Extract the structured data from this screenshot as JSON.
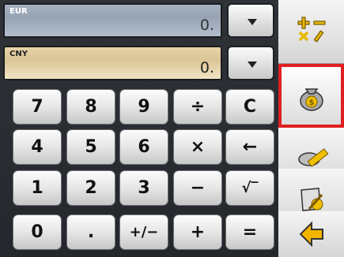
{
  "display": {
    "from": {
      "currency": "EUR",
      "value": "0."
    },
    "to": {
      "currency": "CNY",
      "value": "0."
    }
  },
  "keys": [
    {
      "label": "7",
      "name": "key-7"
    },
    {
      "label": "8",
      "name": "key-8"
    },
    {
      "label": "9",
      "name": "key-9"
    },
    {
      "label": "÷",
      "name": "key-divide"
    },
    {
      "label": "C",
      "name": "key-clear"
    },
    {
      "label": "4",
      "name": "key-4"
    },
    {
      "label": "5",
      "name": "key-5"
    },
    {
      "label": "6",
      "name": "key-6"
    },
    {
      "label": "×",
      "name": "key-multiply"
    },
    {
      "label": "←",
      "name": "key-backspace"
    },
    {
      "label": "1",
      "name": "key-1"
    },
    {
      "label": "2",
      "name": "key-2"
    },
    {
      "label": "3",
      "name": "key-3"
    },
    {
      "label": "−",
      "name": "key-subtract"
    },
    {
      "label": "√‾",
      "name": "key-sqrt"
    },
    {
      "label": "0",
      "name": "key-0"
    },
    {
      "label": ".",
      "name": "key-decimal"
    },
    {
      "label": "+/−",
      "name": "key-negate"
    },
    {
      "label": "+",
      "name": "key-add"
    },
    {
      "label": "=",
      "name": "key-equals"
    }
  ],
  "sidebar": [
    {
      "icon": "calculator-operations-icon"
    },
    {
      "icon": "money-bag-icon",
      "selected": true
    },
    {
      "icon": "ruler-units-icon"
    },
    {
      "icon": "note-edit-icon"
    },
    {
      "icon": "back-arrow-icon"
    }
  ],
  "colors": {
    "selection": "#e02020",
    "from_display": "#a7b3c2",
    "to_display": "#e7d3a8"
  }
}
